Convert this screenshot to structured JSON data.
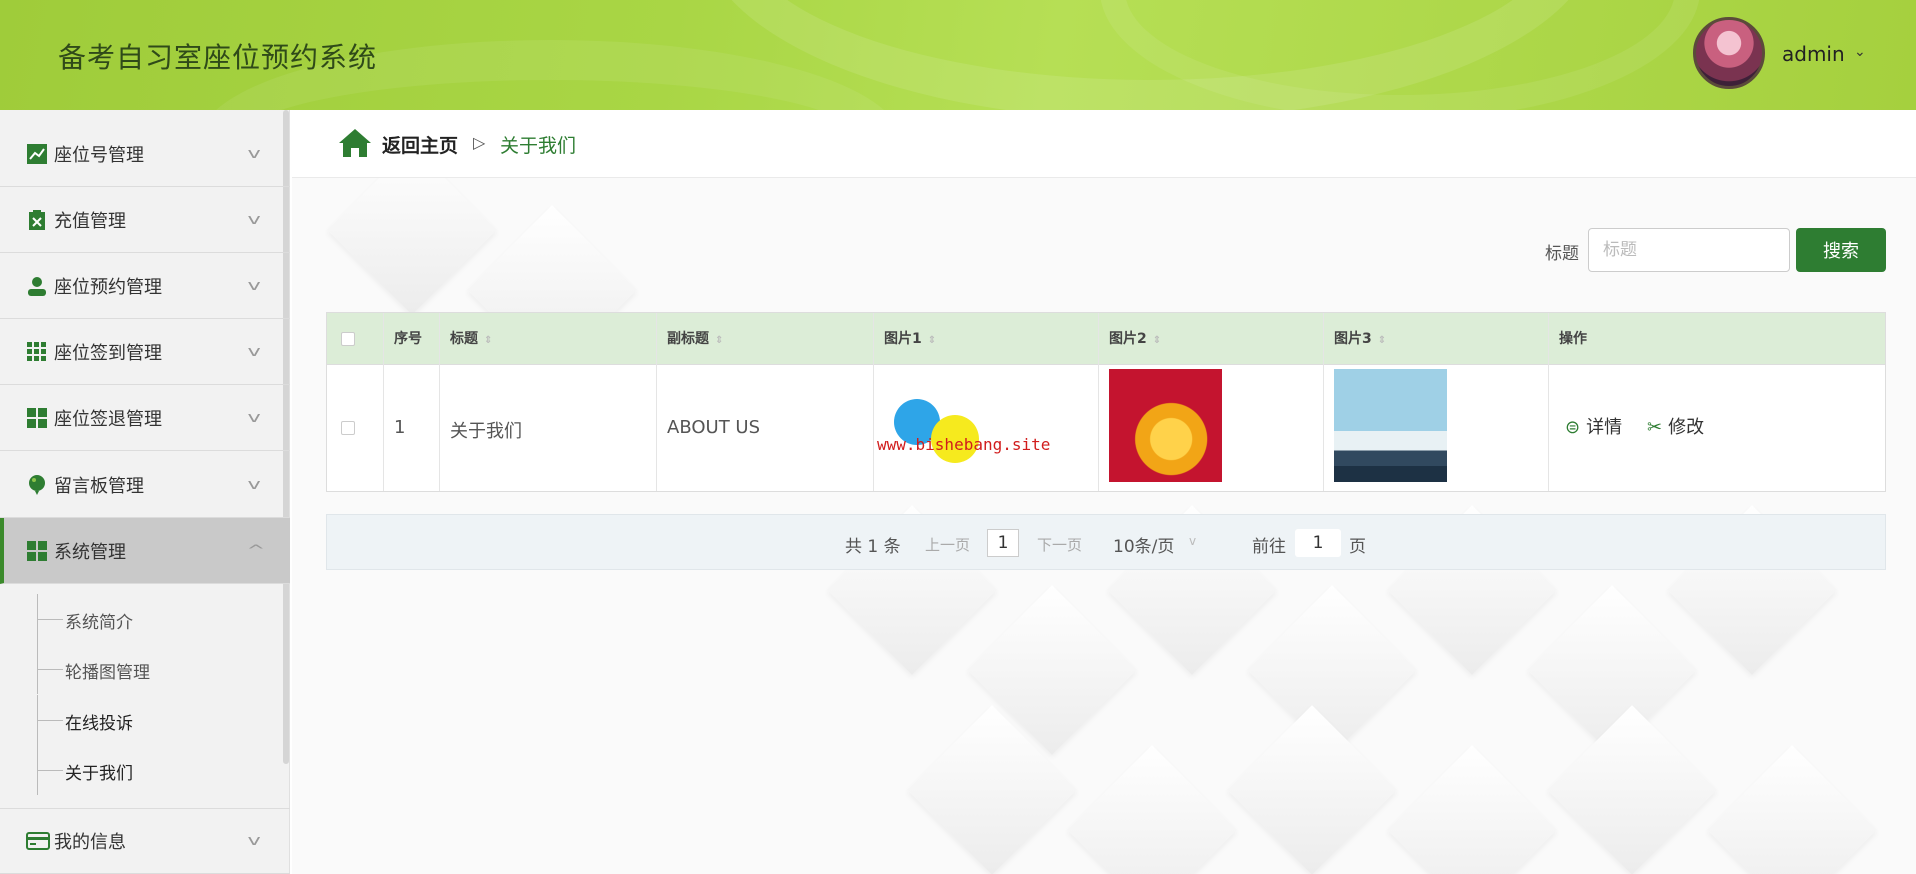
{
  "header": {
    "app_title": "备考自习室座位预约系统",
    "user_name": "admin",
    "user_caret": "⌄"
  },
  "sidebar": {
    "items": [
      {
        "label": "座位号管理",
        "icon": "chart-icon"
      },
      {
        "label": "充值管理",
        "icon": "clipboard-icon"
      },
      {
        "label": "座位预约管理",
        "icon": "user-icon"
      },
      {
        "label": "座位签到管理",
        "icon": "grid-icon"
      },
      {
        "label": "座位签退管理",
        "icon": "grid-icon"
      },
      {
        "label": "留言板管理",
        "icon": "balloon-icon"
      },
      {
        "label": "系统管理",
        "icon": "grid-icon",
        "expanded": true
      },
      {
        "label": "我的信息",
        "icon": "card-icon"
      }
    ],
    "sub_items": [
      "系统简介",
      "轮播图管理",
      "在线投诉",
      "关于我们"
    ]
  },
  "breadcrumb": {
    "home": "返回主页",
    "separator": "▷",
    "current": "关于我们"
  },
  "search": {
    "label": "标题",
    "placeholder": "标题",
    "button": "搜索"
  },
  "table": {
    "columns": [
      "序号",
      "标题",
      "副标题",
      "图片1",
      "图片2",
      "图片3",
      "操作"
    ],
    "rows": [
      {
        "index": "1",
        "title": "关于我们",
        "subtitle": "ABOUT US",
        "image1_watermark": "www.bishebang.site",
        "actions": {
          "detail": "详情",
          "edit": "修改"
        }
      }
    ]
  },
  "pagination": {
    "total": "共 1 条",
    "prev": "上一页",
    "current_page": "1",
    "next": "下一页",
    "page_size": "10条/页",
    "goto_label": "前往",
    "goto_value": "1",
    "goto_suffix": "页"
  },
  "colors": {
    "accent": "#2e7d32",
    "header_green": "#a9d645",
    "table_header": "#dcedd7"
  }
}
